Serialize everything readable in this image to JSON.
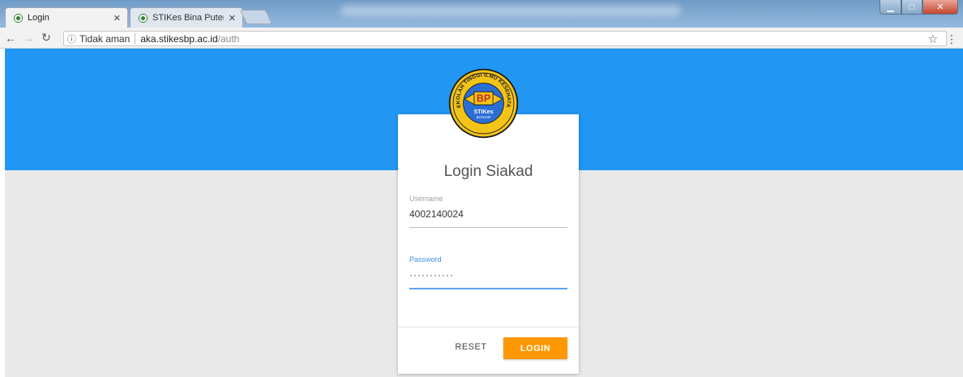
{
  "browser": {
    "tabs": [
      {
        "title": "Login",
        "active": true
      },
      {
        "title": "STIKes Bina Putera Banja",
        "active": false
      }
    ],
    "address": {
      "security_label": "Tidak aman",
      "host": "aka.stikesbp.ac.id",
      "path": "/auth"
    }
  },
  "logo": {
    "text_ring": "SEKOLAH TINGGI ILMU KESEHATAN",
    "monogram": "BP",
    "name": "STIKes",
    "city": "BANJAR"
  },
  "login": {
    "title": "Login Siakad",
    "username_label": "Username",
    "username_value": "4002140024",
    "password_label": "Password",
    "password_value": "···········",
    "reset_label": "RESET",
    "login_label": "LOGIN"
  },
  "colors": {
    "header": "#2196f3",
    "accent": "#ff9800",
    "focus": "#5aa4ec",
    "background": "#e9e9e9"
  }
}
